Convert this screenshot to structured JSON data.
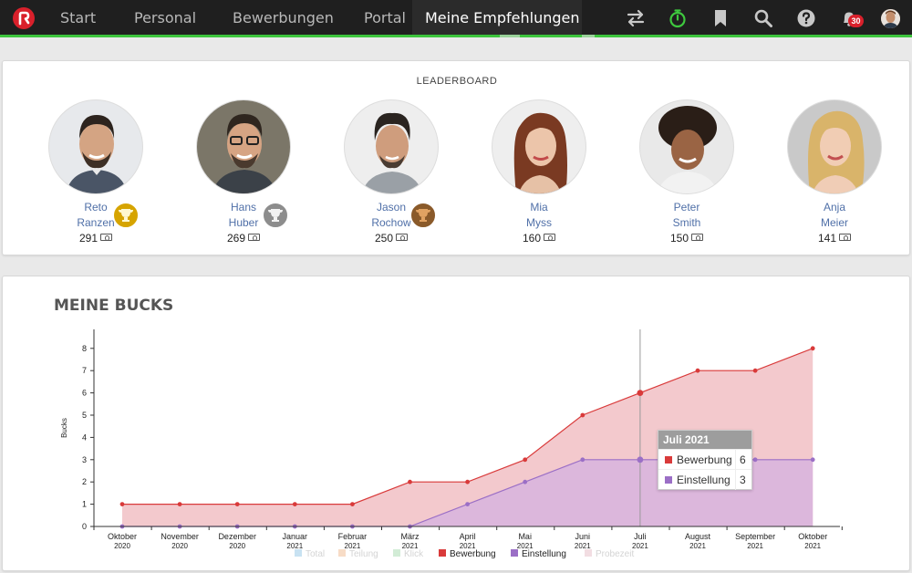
{
  "nav": {
    "items": [
      "Start",
      "Personal",
      "Bewerbungen",
      "Portal",
      "Meine Empfehlungen"
    ],
    "notification_count": "30",
    "icons": [
      "switch-icon",
      "stopwatch-icon",
      "bookmark-icon",
      "search-icon",
      "help-icon",
      "bell-icon"
    ]
  },
  "leaderboard": {
    "title": "LEADERBOARD",
    "people": [
      {
        "first": "Reto",
        "last": "Ranzen",
        "score": "291",
        "trophy": "gold"
      },
      {
        "first": "Hans",
        "last": "Huber",
        "score": "269",
        "trophy": "silver"
      },
      {
        "first": "Jason",
        "last": "Rochow",
        "score": "250",
        "trophy": "bronze"
      },
      {
        "first": "Mia",
        "last": "Myss",
        "score": "160",
        "trophy": ""
      },
      {
        "first": "Peter",
        "last": "Smith",
        "score": "150",
        "trophy": ""
      },
      {
        "first": "Anja",
        "last": "Meier",
        "score": "141",
        "trophy": ""
      }
    ]
  },
  "colors": {
    "gold": "#d6a400",
    "silver": "#9a9a9a",
    "bronze": "#b8742c",
    "bewerbung": "#d93a3a",
    "einstellung": "#9b6fc6"
  },
  "chart_data": {
    "type": "area",
    "title": "MEINE BUCKS",
    "ylabel": "Bucks",
    "xlabel": "",
    "ylim": [
      0,
      8
    ],
    "yticks": [
      0,
      1,
      2,
      3,
      4,
      5,
      6,
      7,
      8
    ],
    "categories": [
      [
        "Oktober",
        "2020"
      ],
      [
        "November",
        "2020"
      ],
      [
        "Dezember",
        "2020"
      ],
      [
        "Januar",
        "2021"
      ],
      [
        "Februar",
        "2021"
      ],
      [
        "März",
        "2021"
      ],
      [
        "April",
        "2021"
      ],
      [
        "Mai",
        "2021"
      ],
      [
        "Juni",
        "2021"
      ],
      [
        "Juli",
        "2021"
      ],
      [
        "August",
        "2021"
      ],
      [
        "September",
        "2021"
      ],
      [
        "Oktober",
        "2021"
      ]
    ],
    "series": [
      {
        "name": "Bewerbung",
        "values": [
          1,
          1,
          1,
          1,
          1,
          2,
          2,
          3,
          5,
          6,
          7,
          7,
          8
        ]
      },
      {
        "name": "Einstellung",
        "values": [
          0,
          0,
          0,
          0,
          0,
          0,
          1,
          2,
          3,
          3,
          3,
          3,
          3
        ]
      }
    ],
    "legend": [
      {
        "name": "Total",
        "active": false,
        "color": "#c8e2f2"
      },
      {
        "name": "Teilung",
        "active": false,
        "color": "#f7dcc6"
      },
      {
        "name": "Klick",
        "active": false,
        "color": "#d2ecd6"
      },
      {
        "name": "Bewerbung",
        "active": true,
        "color": "#d93a3a"
      },
      {
        "name": "Einstellung",
        "active": true,
        "color": "#9b6fc6"
      },
      {
        "name": "Probezeit",
        "active": false,
        "color": "#f2dde2"
      }
    ],
    "legend_position": "bottom",
    "grid": false,
    "tooltip": {
      "title": "Juli 2021",
      "rows": [
        {
          "name": "Bewerbung",
          "value": "6"
        },
        {
          "name": "Einstellung",
          "value": "3"
        }
      ]
    }
  }
}
